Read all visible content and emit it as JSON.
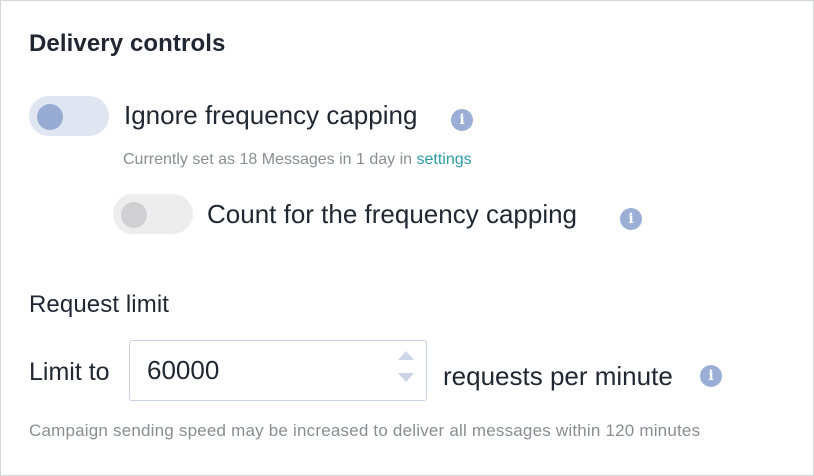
{
  "delivery": {
    "title": "Delivery controls",
    "ignore_capping": {
      "label": "Ignore frequency capping",
      "enabled": true,
      "hint_text": "Currently set as 18 Messages in 1 day in ",
      "hint_link": "settings"
    },
    "count_capping": {
      "label": "Count for the frequency capping",
      "enabled": false
    },
    "info_icon": "i"
  },
  "request_limit": {
    "title": "Request limit",
    "limit_label": "Limit to",
    "value": "60000",
    "unit_label": "requests per minute",
    "footnote": "Campaign sending speed may be increased to deliver all messages within 120 minutes"
  },
  "colors": {
    "accent_link": "#2c9ca8",
    "toggle_active_track": "#dfe6f2",
    "toggle_active_knob": "#97abd3",
    "info_icon": "#9aaed6"
  }
}
